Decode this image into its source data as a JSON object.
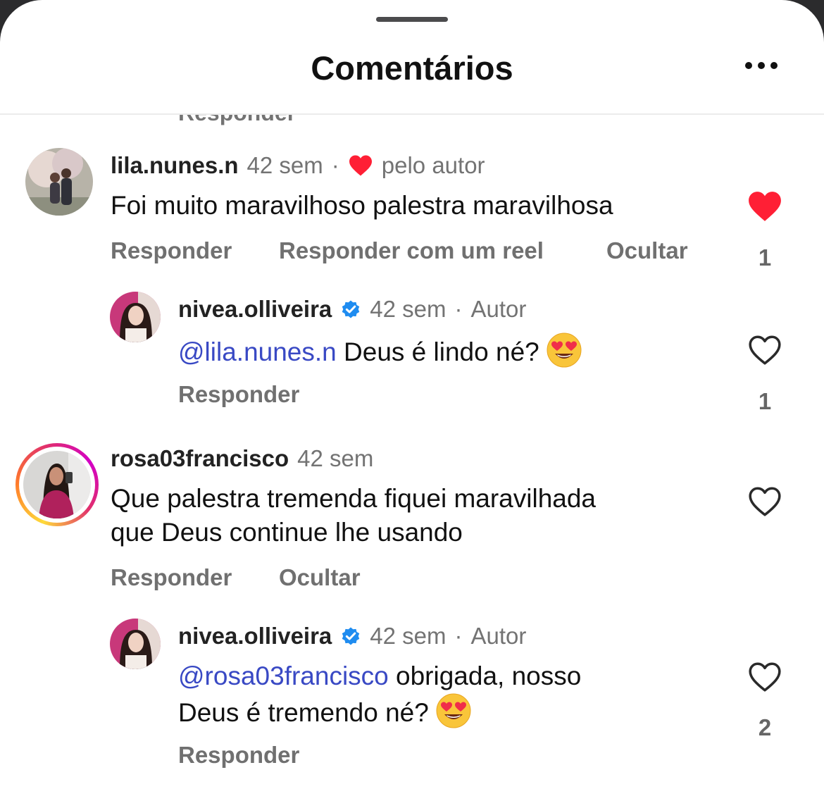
{
  "header": {
    "title": "Comentários"
  },
  "cut_action": "Responder",
  "comments": [
    {
      "username": "lila.nunes.n",
      "time": "42 sem",
      "dot": "·",
      "liked_by_author": "pelo autor",
      "text": "Foi muito maravilhoso palestra maravilhosa",
      "actions": [
        "Responder",
        "Responder com um reel",
        "Ocultar"
      ],
      "likes": "1",
      "liked": true,
      "reply": {
        "username": "nivea.olliveira",
        "time": "42 sem",
        "dot": "·",
        "tag": "Autor",
        "mention": "@lila.nunes.n",
        "text": " Deus é lindo né?",
        "emoji": "smiling-face-with-heart-eyes",
        "action": "Responder",
        "likes": "1"
      }
    },
    {
      "username": "rosa03francisco",
      "time": "42 sem",
      "text_line1": "Que palestra tremenda fiquei maravilhada",
      "text_line2": "que Deus continue lhe usando",
      "actions": [
        "Responder",
        "Ocultar"
      ],
      "reply": {
        "username": "nivea.olliveira",
        "time": "42 sem",
        "dot": "·",
        "tag": "Autor",
        "mention": "@rosa03francisco",
        "text_line1": " obrigada, nosso",
        "text_line2": "Deus é tremendo né?",
        "emoji": "smiling-face-with-heart-eyes",
        "action": "Responder",
        "likes": "2"
      }
    }
  ],
  "colors": {
    "like": "#ff1f35",
    "verified": "#1f8cf0",
    "mention": "#3949c4",
    "story_ring_start": "#feda3a",
    "story_ring_end": "#d300c5"
  }
}
